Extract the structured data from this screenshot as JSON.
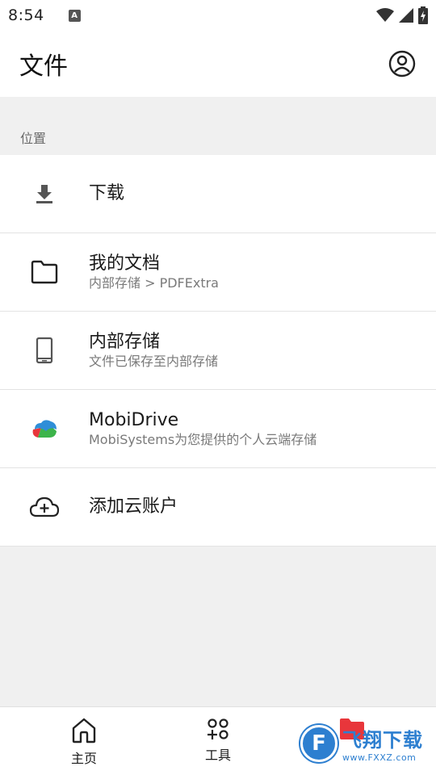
{
  "status_bar": {
    "time": "8:54",
    "notification_icon": "accessibility-a-icon",
    "icons": [
      "wifi-icon",
      "cell-signal-icon",
      "battery-charging-icon"
    ]
  },
  "app_bar": {
    "title": "文件",
    "account_icon": "account-circle-icon"
  },
  "section": {
    "header": "位置"
  },
  "locations": [
    {
      "icon": "download-icon",
      "primary": "下载",
      "secondary": ""
    },
    {
      "icon": "folder-icon",
      "primary": "我的文档",
      "secondary": "内部存储 > PDFExtra"
    },
    {
      "icon": "phone-icon",
      "primary": "内部存储",
      "secondary": "文件已保存至内部存储"
    },
    {
      "icon": "mobidrive-cloud-icon",
      "primary": "MobiDrive",
      "secondary": "MobiSystems为您提供的个人云端存储"
    },
    {
      "icon": "cloud-add-icon",
      "primary": "添加云账户",
      "secondary": ""
    }
  ],
  "bottom_nav": {
    "items": [
      {
        "icon": "home-icon",
        "label": "主页"
      },
      {
        "icon": "tools-icon",
        "label": "工具"
      },
      {
        "icon": "folder-red-icon",
        "label": ""
      }
    ]
  },
  "watermark": {
    "title": "飞翔下载",
    "url": "www.FXXZ.com"
  },
  "colors": {
    "background": "#f0f0f0",
    "surface": "#ffffff",
    "watermark_blue": "#2d7fd0",
    "mobidrive_red": "#e8363b",
    "mobidrive_green": "#3cb44a",
    "mobidrive_blue": "#2f8ed8"
  }
}
